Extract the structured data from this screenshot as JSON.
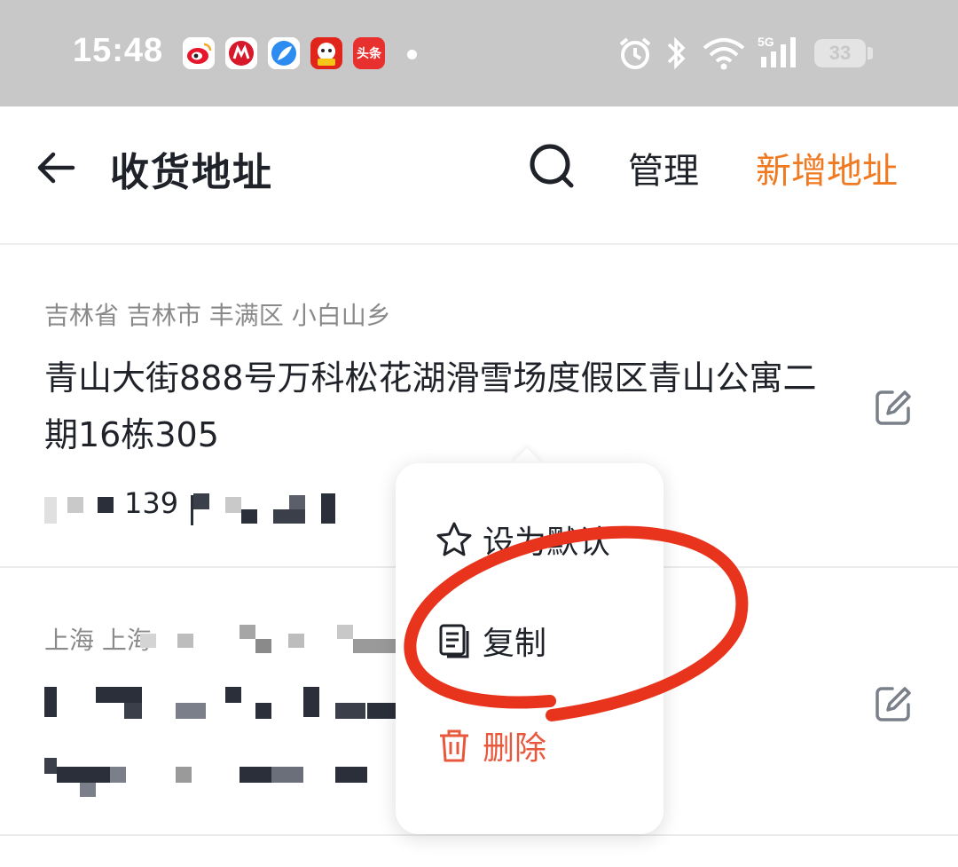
{
  "status_bar": {
    "time": "15:48",
    "app_icons": [
      {
        "icon": "weibo-icon",
        "color": "#f5b80e",
        "text": ""
      },
      {
        "icon": "cmb-bank-icon",
        "color": "#d7182a",
        "text": ""
      },
      {
        "icon": "feather-app-icon",
        "color": "#2d8cf0",
        "text": ""
      },
      {
        "icon": "jd-icon",
        "color": "#e1251b",
        "text": ""
      },
      {
        "icon": "toutiao-icon",
        "color": "#e8302f",
        "text": "头条"
      }
    ],
    "network": "5G",
    "battery": "33"
  },
  "header": {
    "title": "收货地址",
    "manage_label": "管理",
    "add_label": "新增地址",
    "accent_color": "#f07a22"
  },
  "addresses": [
    {
      "region": "吉林省 吉林市 丰满区 小白山乡",
      "street": "青山大街888号万科松花湖滑雪场度假区青山公寓二期16栋305",
      "phone_visible": "139"
    },
    {
      "region": "上海 上海",
      "street": "",
      "phone_visible": ""
    }
  ],
  "context_menu": {
    "items": [
      {
        "label": "设为默认",
        "icon": "star-icon"
      },
      {
        "label": "复制",
        "icon": "copy-icon"
      },
      {
        "label": "删除",
        "icon": "trash-icon",
        "color": "#e8583c"
      }
    ]
  },
  "annotation_color": "#e8341c"
}
